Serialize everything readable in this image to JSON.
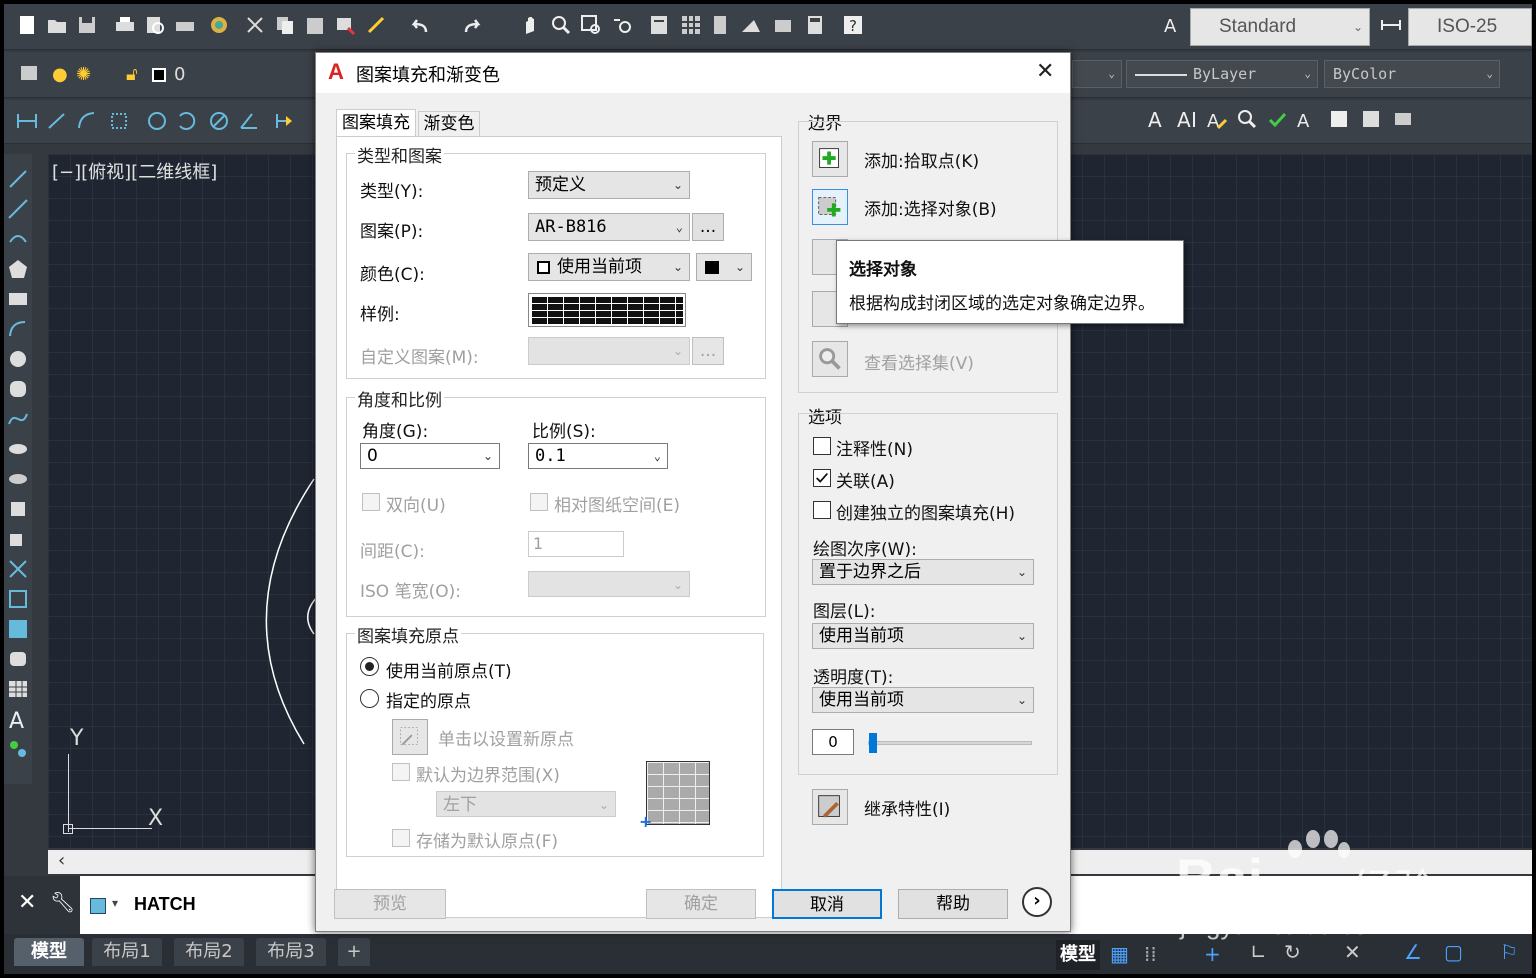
{
  "toolbar": {
    "text_style": "Standard",
    "dim_style": "ISO-25",
    "layer_name": "0",
    "linetype": "ByLayer",
    "lineweight": "ByColor"
  },
  "viewport": {
    "label": "[−][俯视][二维线框]"
  },
  "ucs": {
    "y": "Y",
    "x": "X"
  },
  "command": {
    "text": "HATCH"
  },
  "layout_tabs": [
    "模型",
    "布局1",
    "布局2",
    "布局3",
    "+"
  ],
  "status": {
    "model": "模型"
  },
  "dialog": {
    "title": "图案填充和渐变色",
    "tabs": [
      "图案填充",
      "渐变色"
    ],
    "type_group": {
      "title": "类型和图案",
      "type_label": "类型(Y):",
      "type_value": "预定义",
      "pattern_label": "图案(P):",
      "pattern_value": "AR-B816",
      "browse": "...",
      "color_label": "颜色(C):",
      "color_value": "使用当前项",
      "swatch_label": "样例:",
      "custom_label": "自定义图案(M):",
      "custom_browse": "..."
    },
    "angle_group": {
      "title": "角度和比例",
      "angle_label": "角度(G):",
      "angle_value": "0",
      "scale_label": "比例(S):",
      "scale_value": "0.1",
      "double_label": "双向(U)",
      "paper_label": "相对图纸空间(E)",
      "spacing_label": "间距(C):",
      "spacing_value": "1",
      "iso_label": "ISO 笔宽(O):"
    },
    "origin_group": {
      "title": "图案填充原点",
      "use_current": "使用当前原点(T)",
      "specified": "指定的原点",
      "click_set": "单击以设置新原点",
      "default_extent": "默认为边界范围(X)",
      "extent_value": "左下",
      "store_default": "存储为默认原点(F)"
    },
    "boundary": {
      "title": "边界",
      "add_pick": "添加:拾取点(K)",
      "add_select": "添加:选择对象(B)",
      "view_selection": "查看选择集(V)"
    },
    "options": {
      "title": "选项",
      "annotative": "注释性(N)",
      "associative": "关联(A)",
      "associative_checked": true,
      "independent": "创建独立的图案填充(H)",
      "draw_order_label": "绘图次序(W):",
      "draw_order_value": "置于边界之后",
      "layer_label": "图层(L):",
      "layer_value": "使用当前项",
      "transparency_label": "透明度(T):",
      "transparency_value": "使用当前项",
      "transparency_number": "0"
    },
    "inherit": "继承特性(I)",
    "buttons": {
      "preview": "预览",
      "ok": "确定",
      "cancel": "取消",
      "help": "帮助"
    }
  },
  "tooltip": {
    "title": "选择对象",
    "text": "根据构成封闭区域的选定对象确定边界。"
  },
  "watermark": {
    "brand": "Bai",
    "brand2": "经验",
    "url": "jingyan.baidu.com"
  }
}
